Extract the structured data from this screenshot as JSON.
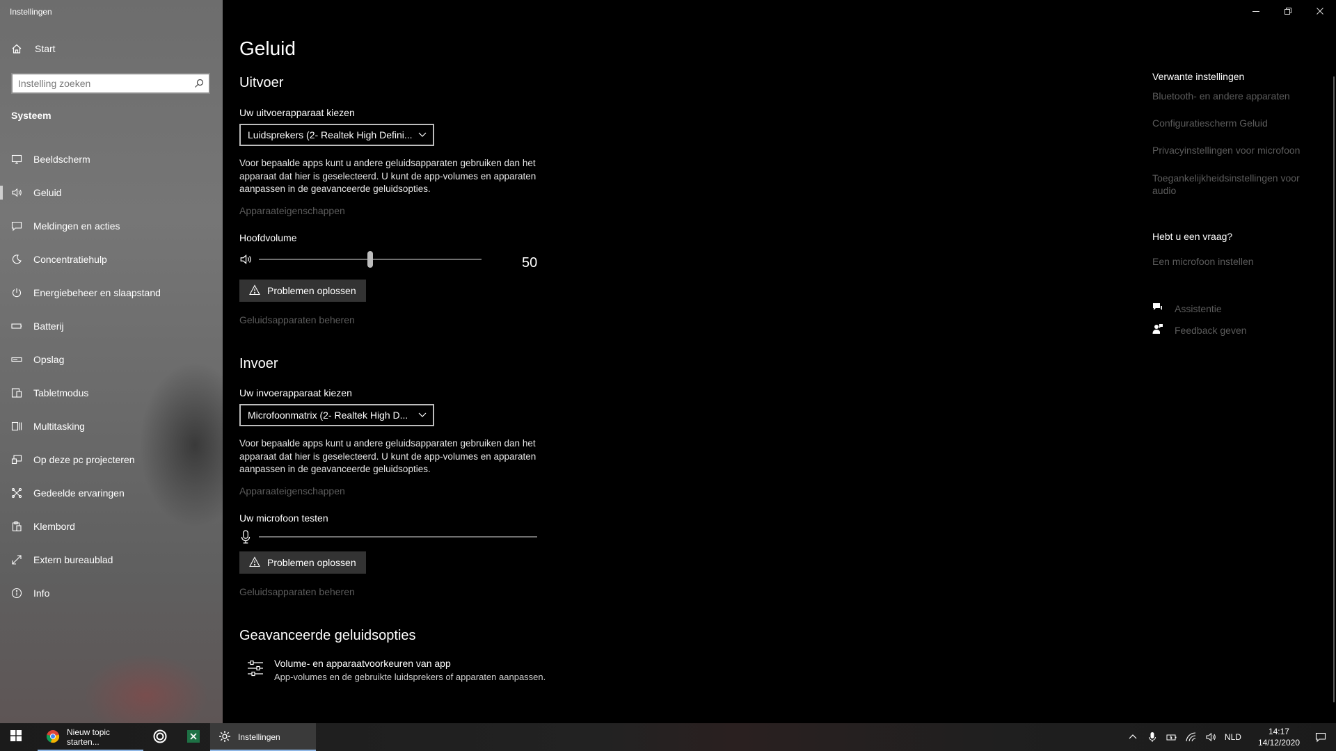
{
  "window": {
    "title": "Instellingen"
  },
  "sidebar": {
    "home_label": "Start",
    "search_placeholder": "Instelling zoeken",
    "section": "Systeem",
    "items": [
      {
        "label": "Beeldscherm",
        "icon": "monitor-icon"
      },
      {
        "label": "Geluid",
        "icon": "speaker-icon",
        "active": true
      },
      {
        "label": "Meldingen en acties",
        "icon": "notification-icon"
      },
      {
        "label": "Concentratiehulp",
        "icon": "moon-icon"
      },
      {
        "label": "Energiebeheer en slaapstand",
        "icon": "power-icon"
      },
      {
        "label": "Batterij",
        "icon": "battery-icon"
      },
      {
        "label": "Opslag",
        "icon": "storage-icon"
      },
      {
        "label": "Tabletmodus",
        "icon": "tablet-icon"
      },
      {
        "label": "Multitasking",
        "icon": "multitasking-icon"
      },
      {
        "label": "Op deze pc projecteren",
        "icon": "project-icon"
      },
      {
        "label": "Gedeelde ervaringen",
        "icon": "shared-icon"
      },
      {
        "label": "Klembord",
        "icon": "clipboard-icon"
      },
      {
        "label": "Extern bureaublad",
        "icon": "remote-desktop-icon"
      },
      {
        "label": "Info",
        "icon": "info-icon"
      }
    ]
  },
  "main": {
    "title": "Geluid",
    "output": {
      "heading": "Uitvoer",
      "device_label": "Uw uitvoerapparaat kiezen",
      "device_value": "Luidsprekers (2- Realtek High Defini...",
      "description": "Voor bepaalde apps kunt u andere geluidsapparaten gebruiken dan het apparaat dat hier is geselecteerd. U kunt de app-volumes en apparaten aanpassen in de geavanceerde geluidsopties.",
      "properties_link": "Apparaateigenschappen",
      "volume_label": "Hoofdvolume",
      "volume_value": "50",
      "volume_fraction": 0.5,
      "troubleshoot": "Problemen oplossen",
      "manage_link": "Geluidsapparaten beheren"
    },
    "input": {
      "heading": "Invoer",
      "device_label": "Uw invoerapparaat kiezen",
      "device_value": "Microfoonmatrix (2- Realtek High D...",
      "description": "Voor bepaalde apps kunt u andere geluidsapparaten gebruiken dan het apparaat dat hier is geselecteerd. U kunt de app-volumes en apparaten aanpassen in de geavanceerde geluidsopties.",
      "properties_link": "Apparaateigenschappen",
      "test_label": "Uw microfoon testen",
      "troubleshoot": "Problemen oplossen",
      "manage_link": "Geluidsapparaten beheren"
    },
    "advanced": {
      "heading": "Geavanceerde geluidsopties",
      "item_title": "Volume- en apparaatvoorkeuren van app",
      "item_sub": "App-volumes en de gebruikte luidsprekers of apparaten aanpassen."
    }
  },
  "related": {
    "heading": "Verwante instellingen",
    "links": [
      "Bluetooth- en andere apparaten",
      "Configuratiescherm Geluid",
      "Privacyinstellingen voor microfoon",
      "Toegankelijkheidsinstellingen voor audio"
    ],
    "question_heading": "Hebt u een vraag?",
    "question_link": "Een microfoon instellen",
    "help": [
      {
        "label": "Assistentie",
        "icon": "chat-help-icon"
      },
      {
        "label": "Feedback geven",
        "icon": "feedback-icon"
      }
    ]
  },
  "taskbar": {
    "apps": [
      {
        "label": "Nieuw topic starten..."
      },
      {
        "label": "Instellingen"
      }
    ],
    "language": "NLD",
    "time": "14:17",
    "date": "14/12/2020"
  }
}
